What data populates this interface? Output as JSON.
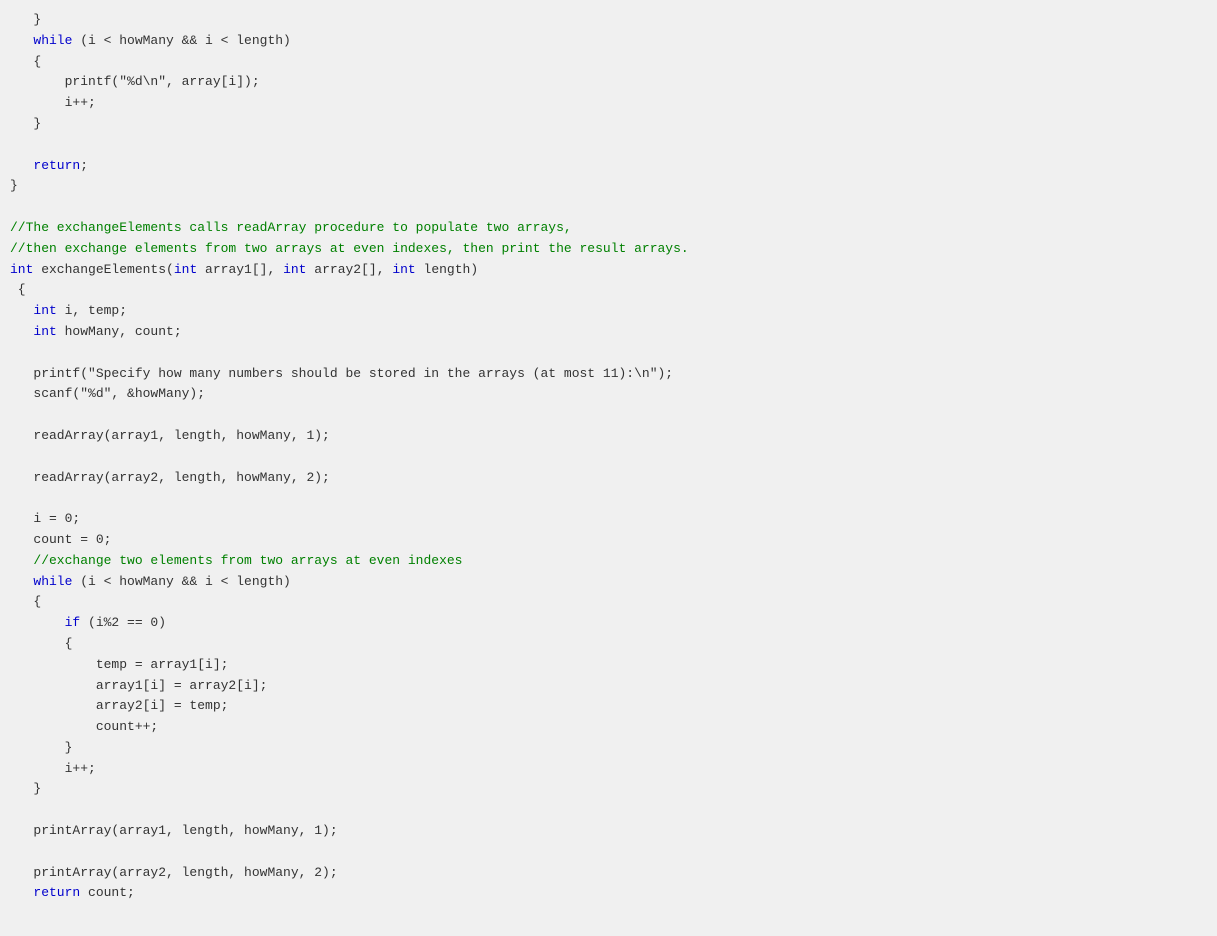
{
  "code": {
    "lines": [
      {
        "tokens": [
          {
            "text": "   }",
            "class": "plain"
          }
        ]
      },
      {
        "tokens": [
          {
            "text": "   ",
            "class": "plain"
          },
          {
            "text": "while",
            "class": "kw"
          },
          {
            "text": " (i < howMany && i < length)",
            "class": "plain"
          }
        ]
      },
      {
        "tokens": [
          {
            "text": "   {",
            "class": "plain"
          }
        ]
      },
      {
        "tokens": [
          {
            "text": "       printf(\"%d\\n\", array[i]);",
            "class": "plain"
          }
        ]
      },
      {
        "tokens": [
          {
            "text": "       i++;",
            "class": "plain"
          }
        ]
      },
      {
        "tokens": [
          {
            "text": "   }",
            "class": "plain"
          }
        ]
      },
      {
        "tokens": [
          {
            "text": "",
            "class": "plain"
          }
        ]
      },
      {
        "tokens": [
          {
            "text": "   ",
            "class": "plain"
          },
          {
            "text": "return",
            "class": "kw"
          },
          {
            "text": ";",
            "class": "plain"
          }
        ]
      },
      {
        "tokens": [
          {
            "text": "}",
            "class": "plain"
          }
        ]
      },
      {
        "tokens": [
          {
            "text": "",
            "class": "plain"
          }
        ]
      },
      {
        "tokens": [
          {
            "text": "//The exchangeElements calls readArray procedure to populate two arrays,",
            "class": "cm"
          }
        ]
      },
      {
        "tokens": [
          {
            "text": "//then exchange elements from two arrays at even indexes, then print the result arrays.",
            "class": "cm"
          }
        ]
      },
      {
        "tokens": [
          {
            "text": "int",
            "class": "type"
          },
          {
            "text": " exchangeElements(",
            "class": "plain"
          },
          {
            "text": "int",
            "class": "type"
          },
          {
            "text": " array1[], ",
            "class": "plain"
          },
          {
            "text": "int",
            "class": "type"
          },
          {
            "text": " array2[], ",
            "class": "plain"
          },
          {
            "text": "int",
            "class": "type"
          },
          {
            "text": " length)",
            "class": "plain"
          }
        ]
      },
      {
        "tokens": [
          {
            "text": " {",
            "class": "plain"
          }
        ]
      },
      {
        "tokens": [
          {
            "text": "   ",
            "class": "plain"
          },
          {
            "text": "int",
            "class": "type"
          },
          {
            "text": " i, temp;",
            "class": "plain"
          }
        ]
      },
      {
        "tokens": [
          {
            "text": "   ",
            "class": "plain"
          },
          {
            "text": "int",
            "class": "type"
          },
          {
            "text": " howMany, count;",
            "class": "plain"
          }
        ]
      },
      {
        "tokens": [
          {
            "text": "",
            "class": "plain"
          }
        ]
      },
      {
        "tokens": [
          {
            "text": "   printf(\"Specify how many numbers should be stored in the arrays (at most 11):\\n\");",
            "class": "plain"
          }
        ]
      },
      {
        "tokens": [
          {
            "text": "   scanf(\"%d\", &howMany);",
            "class": "plain"
          }
        ]
      },
      {
        "tokens": [
          {
            "text": "",
            "class": "plain"
          }
        ]
      },
      {
        "tokens": [
          {
            "text": "   readArray(array1, length, howMany, 1);",
            "class": "plain"
          }
        ]
      },
      {
        "tokens": [
          {
            "text": "",
            "class": "plain"
          }
        ]
      },
      {
        "tokens": [
          {
            "text": "   readArray(array2, length, howMany, 2);",
            "class": "plain"
          }
        ]
      },
      {
        "tokens": [
          {
            "text": "",
            "class": "plain"
          }
        ]
      },
      {
        "tokens": [
          {
            "text": "   i = 0;",
            "class": "plain"
          }
        ]
      },
      {
        "tokens": [
          {
            "text": "   count = 0;",
            "class": "plain"
          }
        ]
      },
      {
        "tokens": [
          {
            "text": "   //exchange two elements from two arrays at even indexes",
            "class": "cm"
          }
        ]
      },
      {
        "tokens": [
          {
            "text": "   ",
            "class": "plain"
          },
          {
            "text": "while",
            "class": "kw"
          },
          {
            "text": " (i < howMany && i < length)",
            "class": "plain"
          }
        ]
      },
      {
        "tokens": [
          {
            "text": "   {",
            "class": "plain"
          }
        ]
      },
      {
        "tokens": [
          {
            "text": "       ",
            "class": "plain"
          },
          {
            "text": "if",
            "class": "kw"
          },
          {
            "text": " (i%2 == 0)",
            "class": "plain"
          }
        ]
      },
      {
        "tokens": [
          {
            "text": "       {",
            "class": "plain"
          }
        ]
      },
      {
        "tokens": [
          {
            "text": "           temp = array1[i];",
            "class": "plain"
          }
        ]
      },
      {
        "tokens": [
          {
            "text": "           array1[i] = array2[i];",
            "class": "plain"
          }
        ]
      },
      {
        "tokens": [
          {
            "text": "           array2[i] = temp;",
            "class": "plain"
          }
        ]
      },
      {
        "tokens": [
          {
            "text": "           count++;",
            "class": "plain"
          }
        ]
      },
      {
        "tokens": [
          {
            "text": "       }",
            "class": "plain"
          }
        ]
      },
      {
        "tokens": [
          {
            "text": "       i++;",
            "class": "plain"
          }
        ]
      },
      {
        "tokens": [
          {
            "text": "   }",
            "class": "plain"
          }
        ]
      },
      {
        "tokens": [
          {
            "text": "",
            "class": "plain"
          }
        ]
      },
      {
        "tokens": [
          {
            "text": "   printArray(array1, length, howMany, 1);",
            "class": "plain"
          }
        ]
      },
      {
        "tokens": [
          {
            "text": "",
            "class": "plain"
          }
        ]
      },
      {
        "tokens": [
          {
            "text": "   printArray(array2, length, howMany, 2);",
            "class": "plain"
          }
        ]
      },
      {
        "tokens": [
          {
            "text": "   ",
            "class": "plain"
          },
          {
            "text": "return",
            "class": "kw"
          },
          {
            "text": " count;",
            "class": "plain"
          }
        ]
      }
    ]
  }
}
